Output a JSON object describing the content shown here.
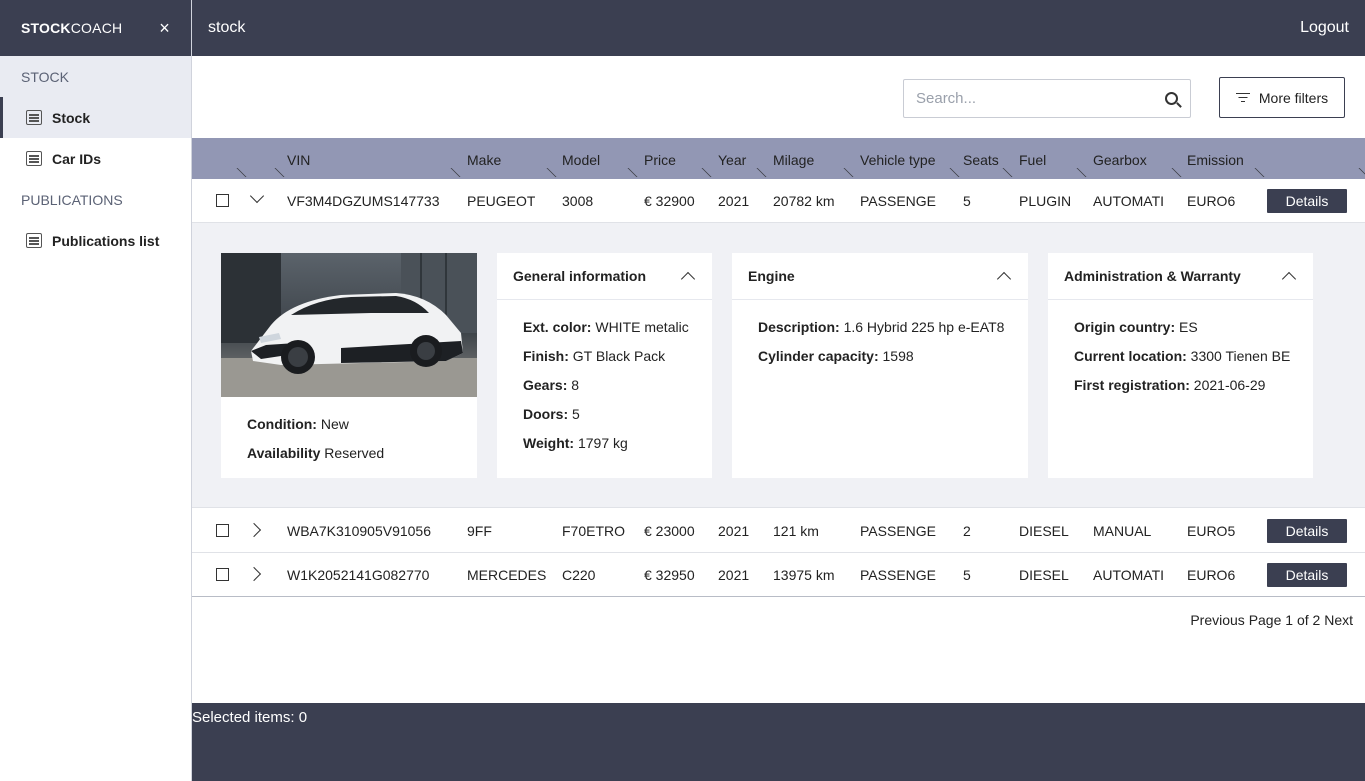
{
  "sidebar": {
    "brand_bold": "STOCK",
    "brand_rest": "COACH",
    "close_glyph": "×",
    "sections": [
      {
        "label": "STOCK",
        "items": [
          {
            "label": "Stock",
            "icon": "list-icon",
            "active": true
          },
          {
            "label": "Car IDs",
            "icon": "list-icon"
          }
        ]
      },
      {
        "label": "PUBLICATIONS",
        "items": [
          {
            "label": "Publications list",
            "icon": "list-icon"
          }
        ]
      }
    ]
  },
  "topbar": {
    "title": "stock",
    "logout": "Logout"
  },
  "toolbar": {
    "search_placeholder": "Search...",
    "more_filters": "More filters"
  },
  "table": {
    "columns": [
      "VIN",
      "Make",
      "Model",
      "Price",
      "Year",
      "Milage",
      "Vehicle type",
      "Seats",
      "Fuel",
      "Gearbox",
      "Emission"
    ],
    "details_label": "Details",
    "rows": [
      {
        "vin": "VF3M4DGZUMS147733",
        "make": "PEUGEOT",
        "model": "3008",
        "price": "€ 32900",
        "year": "2021",
        "milage": "20782 km",
        "type": "PASSENGE",
        "seats": "5",
        "fuel": "PLUGIN",
        "gearbox": "AUTOMATI",
        "emission": "EURO6",
        "expanded": true
      },
      {
        "vin": "WBA7K310905V91056",
        "make": "9FF",
        "model": "F70ETRO",
        "price": "€ 23000",
        "year": "2021",
        "milage": "121 km",
        "type": "PASSENGE",
        "seats": "2",
        "fuel": "DIESEL",
        "gearbox": "MANUAL",
        "emission": "EURO5",
        "expanded": false
      },
      {
        "vin": "W1K2052141G082770",
        "make": "MERCEDES",
        "model": "C220",
        "price": "€ 32950",
        "year": "2021",
        "milage": "13975 km",
        "type": "PASSENGE",
        "seats": "5",
        "fuel": "DIESEL",
        "gearbox": "AUTOMATI",
        "emission": "EURO6",
        "expanded": false
      }
    ]
  },
  "detail": {
    "condition_label": "Condition:",
    "condition_value": "New",
    "availability_label": "Availability",
    "availability_value": "Reserved",
    "general": {
      "title": "General information",
      "fields": [
        {
          "label": "Ext. color:",
          "value": "WHITE metalic"
        },
        {
          "label": "Finish:",
          "value": "GT Black Pack"
        },
        {
          "label": "Gears:",
          "value": "8"
        },
        {
          "label": "Doors:",
          "value": "5"
        },
        {
          "label": "Weight:",
          "value": "1797 kg"
        }
      ]
    },
    "engine": {
      "title": "Engine",
      "fields": [
        {
          "label": "Description:",
          "value": "1.6 Hybrid 225 hp e-EAT8"
        },
        {
          "label": "Cylinder capacity:",
          "value": "1598"
        }
      ]
    },
    "admin": {
      "title": "Administration & Warranty",
      "fields": [
        {
          "label": "Origin country:",
          "value": "ES"
        },
        {
          "label": "Current location:",
          "value": "3300 Tienen BE"
        },
        {
          "label": "First registration:",
          "value": "2021-06-29"
        }
      ]
    }
  },
  "pagination": {
    "previous": "Previous",
    "page_text": "Page 1 of 2",
    "next": "Next"
  },
  "footer": {
    "selected": "Selected items: 0"
  },
  "colors": {
    "dark": "#3b3f51",
    "header": "#9297b4",
    "panel": "#f0f1f5",
    "active_nav": "#e9ebf2"
  }
}
